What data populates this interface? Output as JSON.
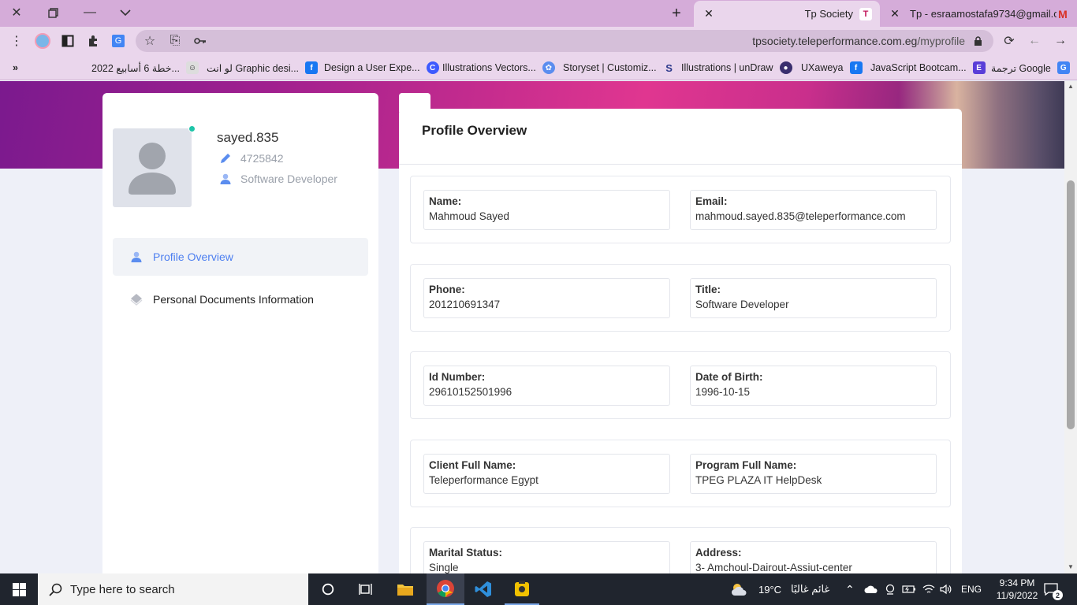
{
  "browser": {
    "tabs": [
      {
        "title": "Tp Society",
        "active": true
      },
      {
        "title": "Tp - esraamostafa9734@gmail.co",
        "active": false
      }
    ],
    "url_host": "tpsociety.teleperformance.com.eg",
    "url_path": "/myprofile",
    "bookmarks": [
      "ترجمة Google",
      "JavaScript Bootcam...",
      "UXaweya",
      "Illustrations | unDraw",
      "Storyset | Customiz...",
      "Illustrations Vectors...",
      "Design a User Expe...",
      "لو انت Graphic desi...",
      "خطة 6 أسابيع 2022..."
    ],
    "bookmarks_overflow": "»"
  },
  "profile": {
    "username": "sayed.835",
    "employee_id": "4725842",
    "job_title": "Software Developer",
    "nav": [
      {
        "label": "Profile Overview",
        "active": true
      },
      {
        "label": "Personal Documents Information",
        "active": false
      }
    ]
  },
  "overview": {
    "title": "Profile Overview",
    "rows": [
      [
        {
          "label": "Name:",
          "value": "Mahmoud Sayed"
        },
        {
          "label": "Email:",
          "value": "mahmoud.sayed.835@teleperformance.com"
        }
      ],
      [
        {
          "label": "Phone:",
          "value": "201210691347"
        },
        {
          "label": "Title:",
          "value": "Software Developer"
        }
      ],
      [
        {
          "label": "Id Number:",
          "value": "29610152501996"
        },
        {
          "label": "Date of Birth:",
          "value": "1996-10-15"
        }
      ],
      [
        {
          "label": "Client Full Name:",
          "value": "Teleperformance Egypt"
        },
        {
          "label": "Program Full Name:",
          "value": "TPEG PLAZA IT HelpDesk"
        }
      ],
      [
        {
          "label": "Marital Status:",
          "value": "Single"
        },
        {
          "label": "Address:",
          "value": "3- Amchoul-Dairout-Assiut-center"
        }
      ]
    ]
  },
  "taskbar": {
    "search_placeholder": "Type here to search",
    "weather_temp": "19°C",
    "weather_text": "غائم غالبًا",
    "language": "ENG",
    "time": "9:34 PM",
    "date": "11/9/2022",
    "notification_count": "2"
  },
  "colors": {
    "accent": "#4d7ff0",
    "online": "#1ec5a8",
    "chrome_tabbar": "#d5acd9",
    "chrome_toolbar": "#ead6ec"
  }
}
